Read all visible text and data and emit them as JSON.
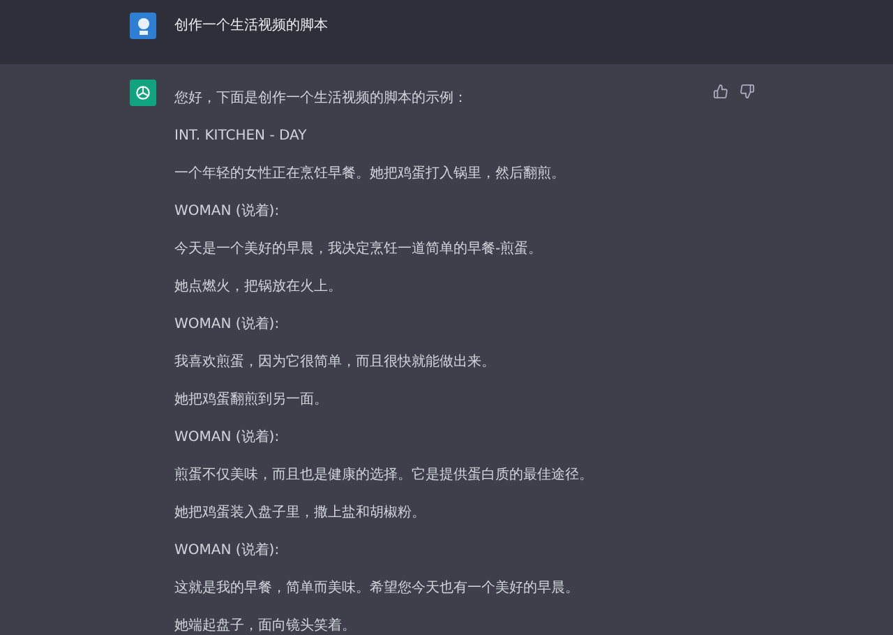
{
  "user_message": {
    "text": "创作一个生活视频的脚本"
  },
  "assistant_message": {
    "paragraphs": [
      "您好，下面是创作一个生活视频的脚本的示例：",
      "INT. KITCHEN - DAY",
      "一个年轻的女性正在烹饪早餐。她把鸡蛋打入锅里，然后翻煎。",
      "WOMAN (说着):",
      "今天是一个美好的早晨，我决定烹饪一道简单的早餐-煎蛋。",
      "她点燃火，把锅放在火上。",
      "WOMAN (说着):",
      "我喜欢煎蛋，因为它很简单，而且很快就能做出来。",
      "她把鸡蛋翻煎到另一面。",
      "WOMAN (说着):",
      "煎蛋不仅美味，而且也是健康的选择。它是提供蛋白质的最佳途径。",
      "她把鸡蛋装入盘子里，撒上盐和胡椒粉。",
      "WOMAN (说着):",
      "这就是我的早餐，简单而美味。希望您今天也有一个美好的早晨。",
      "她端起盘子，面向镜头笑着。"
    ]
  }
}
